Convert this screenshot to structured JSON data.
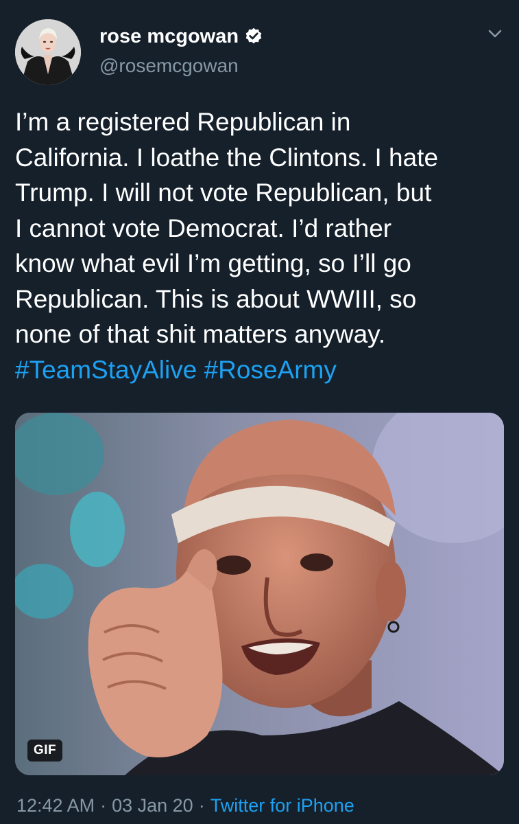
{
  "user": {
    "display_name": "rose mcgowan",
    "handle": "@rosemcgowan",
    "verified_icon": "verified-badge-icon"
  },
  "tweet": {
    "lines": [
      "I’m a registered Republican in",
      "California. I loathe the Clintons. I hate",
      "Trump. I will not vote Republican, but",
      "I cannot vote Democrat. I’d rather",
      "know what evil I’m getting, so I’ll go",
      "Republican. This is about WWIII, so",
      "none of that shit matters anyway."
    ],
    "hashtags": [
      "#TeamStayAlive",
      "#RoseArmy"
    ]
  },
  "media": {
    "badge": "GIF"
  },
  "footer": {
    "time": "12:42 AM",
    "separator": "·",
    "date": "03 Jan 20",
    "source": "Twitter for iPhone"
  },
  "colors": {
    "background": "#15202b",
    "text": "#ffffff",
    "secondary": "#8899a6",
    "accent": "#1da1f2"
  }
}
